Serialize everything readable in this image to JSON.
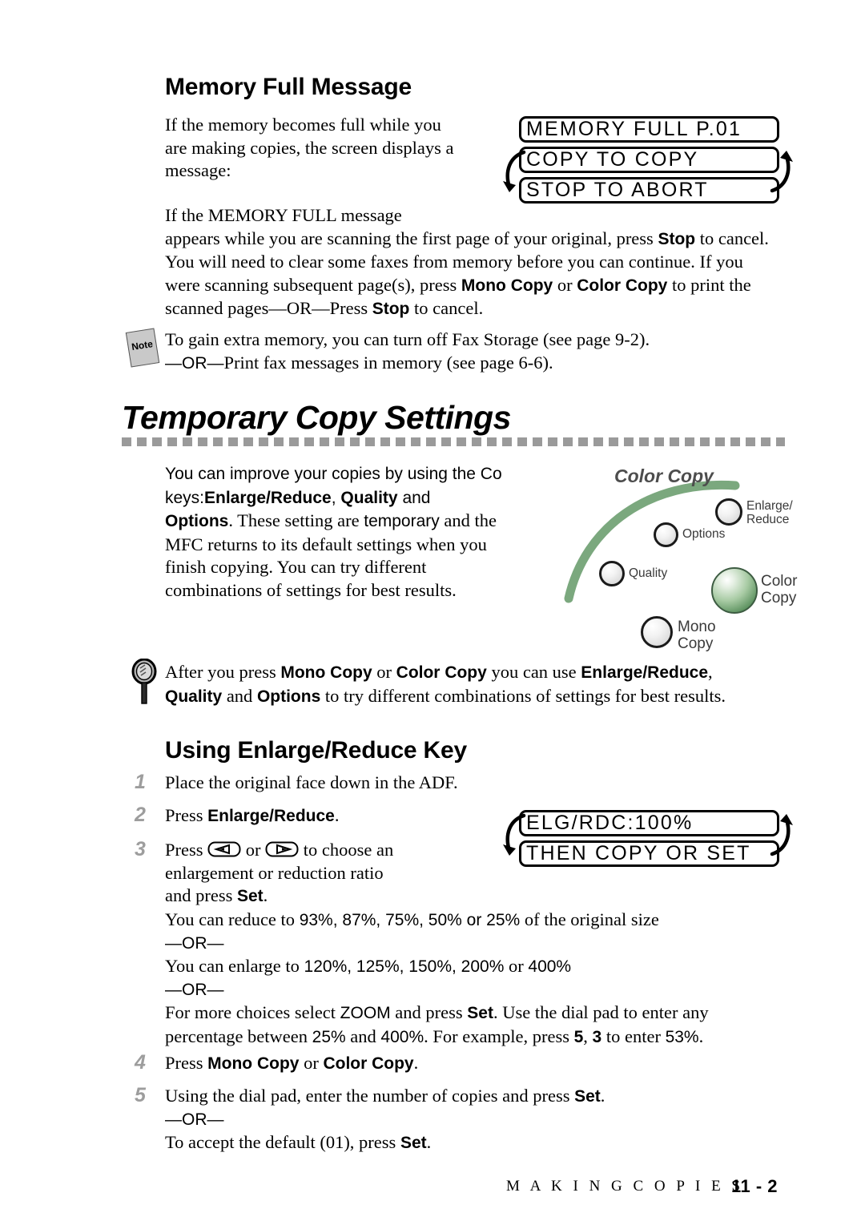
{
  "section1": {
    "heading": "Memory Full Message",
    "intro_lines": [
      "If the memory becomes full while you",
      "are making copies, the screen displays a",
      "message:"
    ],
    "lcd": {
      "line1": "MEMORY FULL P.01",
      "line2": "COPY TO COPY",
      "line3": "STOP TO ABORT"
    },
    "body_line1": "If the MEMORY FULL message",
    "body_rest_pre": "appears while you are scanning the first page of your original, press ",
    "body_stop1": "Stop",
    "body_rest_2": " to cancel. You will need to clear some faxes from memory before you can continue. If you were scanning subsequent page(s), press ",
    "body_mono": "Mono Copy",
    "body_or1": " or ",
    "body_color": "Color Copy",
    "body_rest_3": " to print the scanned pages—OR—Press ",
    "body_stop2": "Stop",
    "body_rest_4": " to cancel."
  },
  "note": {
    "icon_label": "Note",
    "line1": "To gain extra memory, you can turn off Fax Storage (see page 9-2).",
    "line2_or": "—OR—",
    "line2_rest": "Print fax messages in memory (see page 6-6)."
  },
  "section2": {
    "heading": "Temporary Copy Settings",
    "para_part1": "You can improve your copies by using the Co",
    "para_part2_pre": "keys:",
    "para_enlarge": "Enlarge/Reduce",
    "para_comma": ", ",
    "para_quality": "Quality",
    "para_and": " and",
    "para_options": "Options",
    "para_after_options": ".  These setting are ",
    "para_temporary": "temporary",
    "para_after_temp": " and the",
    "para_tail_lines": [
      "MFC returns to its default settings when you",
      "finish copying. You can try different",
      "combinations of settings for best results."
    ]
  },
  "panel": {
    "title": "Color Copy",
    "buttons": [
      {
        "name": "enlarge-reduce",
        "label_line1": "Enlarge/",
        "label_line2": "Reduce"
      },
      {
        "name": "options",
        "label_line1": "Options",
        "label_line2": ""
      },
      {
        "name": "quality",
        "label_line1": "Quality",
        "label_line2": ""
      },
      {
        "name": "color-copy",
        "label_line1": "Color",
        "label_line2": "Copy"
      },
      {
        "name": "mono-copy",
        "label_line1": "Mono",
        "label_line2": "Copy"
      }
    ],
    "accent_color": "#7ba87e",
    "color_copy_button_color": "#6a9b6c"
  },
  "tip": {
    "pre": "After you press ",
    "mono": "Mono Copy",
    "or": " or ",
    "color": "Color Copy",
    "mid": " you can use ",
    "enlarge": "Enlarge/Reduce",
    "comma": ",",
    "quality": "Quality",
    "and": " and ",
    "options": "Options",
    "tail": " to try different combinations of settings for best results."
  },
  "section3": {
    "heading": "Using Enlarge/Reduce Key",
    "steps": [
      {
        "num": "1",
        "text": "Place the original face down in the ADF."
      },
      {
        "num": "2",
        "pre": "Press ",
        "bold": "Enlarge/Reduce",
        "post": "."
      },
      {
        "num": "3",
        "line1_pre": "Press ",
        "line1_mid": " or ",
        "line1_post": " to choose an",
        "line2": "enlargement or reduction ratio",
        "line3_pre": "and press ",
        "line3_bold": "Set",
        "line3_post": "."
      },
      {
        "num": "4",
        "pre": "Press ",
        "bold1": "Mono Copy",
        "mid": " or ",
        "bold2": "Color Copy",
        "post": "."
      },
      {
        "num": "5",
        "line1_pre": "Using the dial pad, enter the number of copies and press ",
        "line1_bold": "Set",
        "line1_post": ".",
        "line2_or": "—OR—",
        "line3_pre": "To accept the default (01), press ",
        "line3_bold": "Set",
        "line3_post": "."
      }
    ],
    "lcd": {
      "line1": "ELG/RDC:100%",
      "line2": "THEN COPY OR SET"
    },
    "reduce_line_pre": "You can reduce to ",
    "reduce_values": "93%, 87%, 75%,  50% or 25%",
    "reduce_line_post": " of the original size",
    "or1": "—OR—",
    "enlarge_line_pre": "You can enlarge to ",
    "enlarge_values": "120%, 125%, 150%, 200%",
    "enlarge_line_mid": " or ",
    "enlarge_values2": "400%",
    "or2": "—OR—",
    "zoom_pre": "For more choices select ",
    "zoom_word": "ZOOM",
    "zoom_mid": " and press ",
    "zoom_set": "Set",
    "zoom_post": ". Use the dial pad to enter any",
    "zoom_line2_pre": "percentage between ",
    "zoom_25": "25%",
    "zoom_and": " and ",
    "zoom_400": "400%",
    "zoom_line2_mid": ". For example, press ",
    "zoom_5": "5",
    "zoom_c": ", ",
    "zoom_3": "3",
    "zoom_line2_post": " to enter ",
    "zoom_53": "53%",
    "zoom_end": "."
  },
  "footer": {
    "title": "M A K I N G   C O P I E S",
    "page": "11 - 2"
  }
}
